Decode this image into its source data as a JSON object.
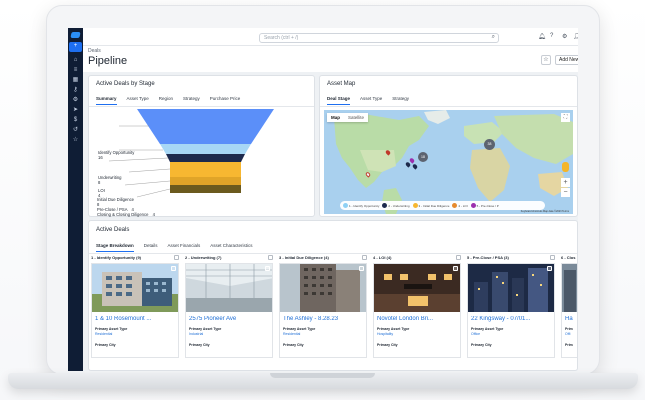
{
  "topbar": {
    "search_placeholder": "Search (ctrl + /)"
  },
  "header": {
    "breadcrumb": "Deals",
    "title": "Pipeline",
    "add_button": "Add New Deal"
  },
  "stage_chart": {
    "title": "Active Deals by Stage",
    "tabs": [
      "Summary",
      "Asset Type",
      "Region",
      "Strategy",
      "Purchase Price"
    ],
    "active_tab": "Summary",
    "stages": [
      {
        "name": "Identify Opportunity",
        "count": "16"
      },
      {
        "name": "Underwriting",
        "count": "8"
      },
      {
        "name": "LOI",
        "count": "4"
      },
      {
        "name": "Initial Due Diligence",
        "count": "8"
      },
      {
        "name": "Pre-Close / PSA",
        "count": "4"
      },
      {
        "name": "Closing & Closing Diligence",
        "count": "4"
      }
    ],
    "colors": [
      "#5b8ff9",
      "#a7d7f5",
      "#1d2a4d",
      "#f7b731",
      "#e0a428",
      "#6b5a1e"
    ]
  },
  "asset_map": {
    "title": "Asset Map",
    "tabs": [
      "Deal Stage",
      "Asset Type",
      "Strategy"
    ],
    "active_tab": "Deal Stage",
    "map_button": "Map",
    "satellite_button": "Satellite",
    "clusters": [
      "38",
      "18"
    ],
    "legend": [
      {
        "label": "1 - Identify Opportunity",
        "color": "#8fd1f5"
      },
      {
        "label": "2 - Underwriting",
        "color": "#1d2a4d"
      },
      {
        "label": "3 - Initial Due Diligence",
        "color": "#f7b731"
      },
      {
        "label": "4 - LOI",
        "color": "#e68a2e"
      },
      {
        "label": "5 - Pre-Close / P",
        "color": "#9b2fae"
      }
    ],
    "footer": "Keyboard shortcuts   Map data ©2023   Terms"
  },
  "active_deals": {
    "title": "Active Deals",
    "tabs": [
      "Stage Breakdown",
      "Details",
      "Asset Financials",
      "Asset Characteristics"
    ],
    "active_tab": "Stage Breakdown",
    "stages": [
      {
        "header": "1 - Identify Opportunity (9)",
        "deal": {
          "name": "1 & 10 Rosemount ...",
          "asset_label": "Primary Asset Type",
          "asset": "Residential",
          "city_label": "Primary City"
        }
      },
      {
        "header": "2 - Underwriting (7)",
        "deal": {
          "name": "2575 Pioneer Ave",
          "asset_label": "Primary Asset Type",
          "asset": "Industrial",
          "city_label": "Primary City"
        }
      },
      {
        "header": "3 - Initial Due Diligence (4)",
        "deal": {
          "name": "The Ashley - 8.28.23",
          "asset_label": "Primary Asset Type",
          "asset": "Residential",
          "city_label": "Primary City"
        }
      },
      {
        "header": "4 - LOI (4)",
        "deal": {
          "name": "Novotel London Bri...",
          "asset_label": "Primary Asset Type",
          "asset": "Hospitality",
          "city_label": "Primary City"
        }
      },
      {
        "header": "5 - Pre-Close / PSA (3)",
        "deal": {
          "name": "22 Kingsway - 07/01...",
          "asset_label": "Primary Asset Type",
          "asset": "Office",
          "city_label": "Primary City"
        }
      },
      {
        "header": "6 - Clos",
        "deal": {
          "name": "Ha",
          "asset_label": "Prim",
          "asset": "Offi",
          "city_label": "Prim"
        }
      }
    ]
  }
}
